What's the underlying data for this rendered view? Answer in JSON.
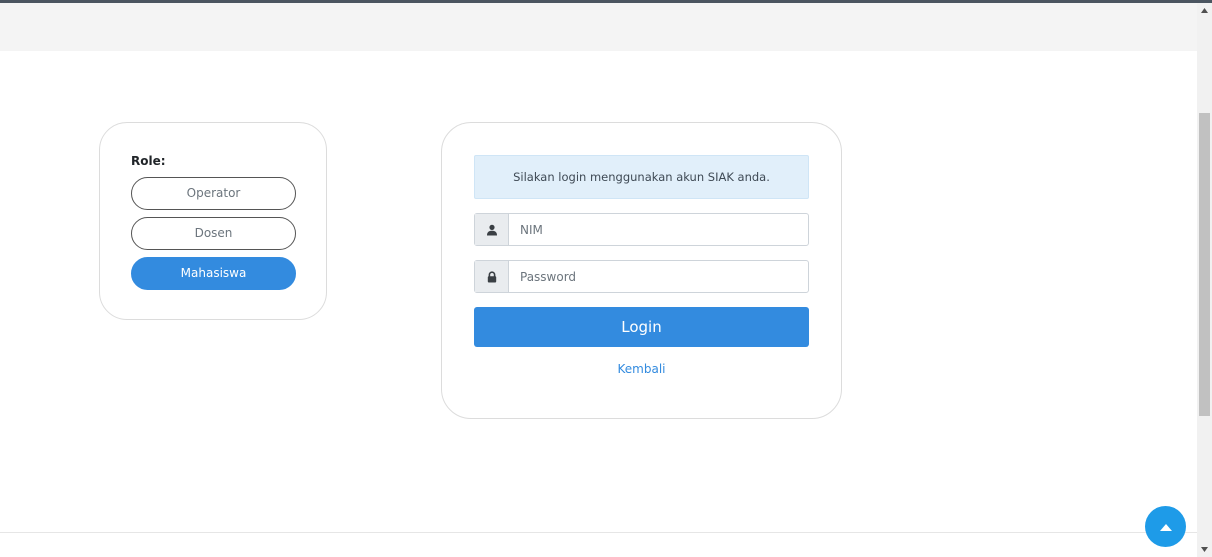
{
  "role_panel": {
    "label": "Role:",
    "options": [
      {
        "label": "Operator"
      },
      {
        "label": "Dosen"
      },
      {
        "label": "Mahasiswa"
      }
    ],
    "selected": "Mahasiswa"
  },
  "login": {
    "notice": "Silakan login menggunakan akun SIAK anda.",
    "nim_placeholder": "NIM",
    "password_placeholder": "Password",
    "submit_label": "Login",
    "back_label": "Kembali"
  },
  "colors": {
    "accent": "#338bdf",
    "notice_bg": "#e1effa",
    "to_top_button": "#1e9be8"
  },
  "icons": {
    "nim": "user-icon",
    "password": "lock-icon",
    "to_top": "arrow-up-icon"
  }
}
